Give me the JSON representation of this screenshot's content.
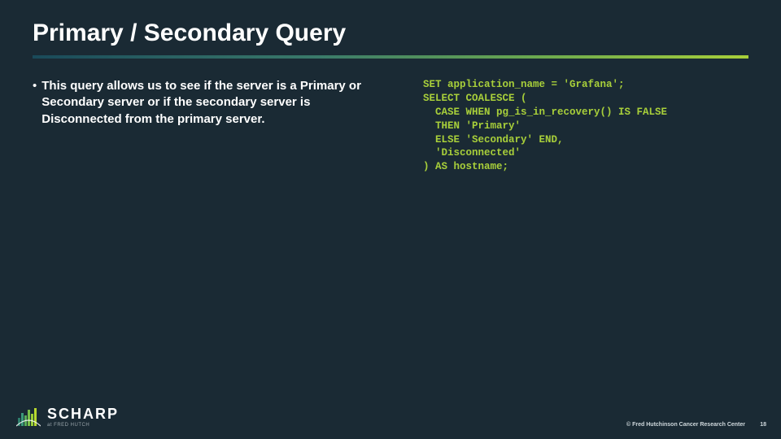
{
  "title": "Primary / Secondary Query",
  "bullet": {
    "marker": "•",
    "text": "This query allows us to see if the server is a Primary or Secondary server or if the secondary server is Disconnected from the primary server."
  },
  "code": {
    "lines": [
      "SET application_name = 'Grafana';",
      "SELECT COALESCE (",
      "  CASE WHEN pg_is_in_recovery() IS FALSE",
      "  THEN 'Primary'",
      "  ELSE 'Secondary' END,",
      "  'Disconnected'",
      ") AS hostname;"
    ]
  },
  "footer": {
    "logo_main": "SCHARP",
    "logo_sub": "at FRED HUTCH",
    "copyright": "© Fred Hutchinson Cancer Research Center",
    "page": "18"
  }
}
